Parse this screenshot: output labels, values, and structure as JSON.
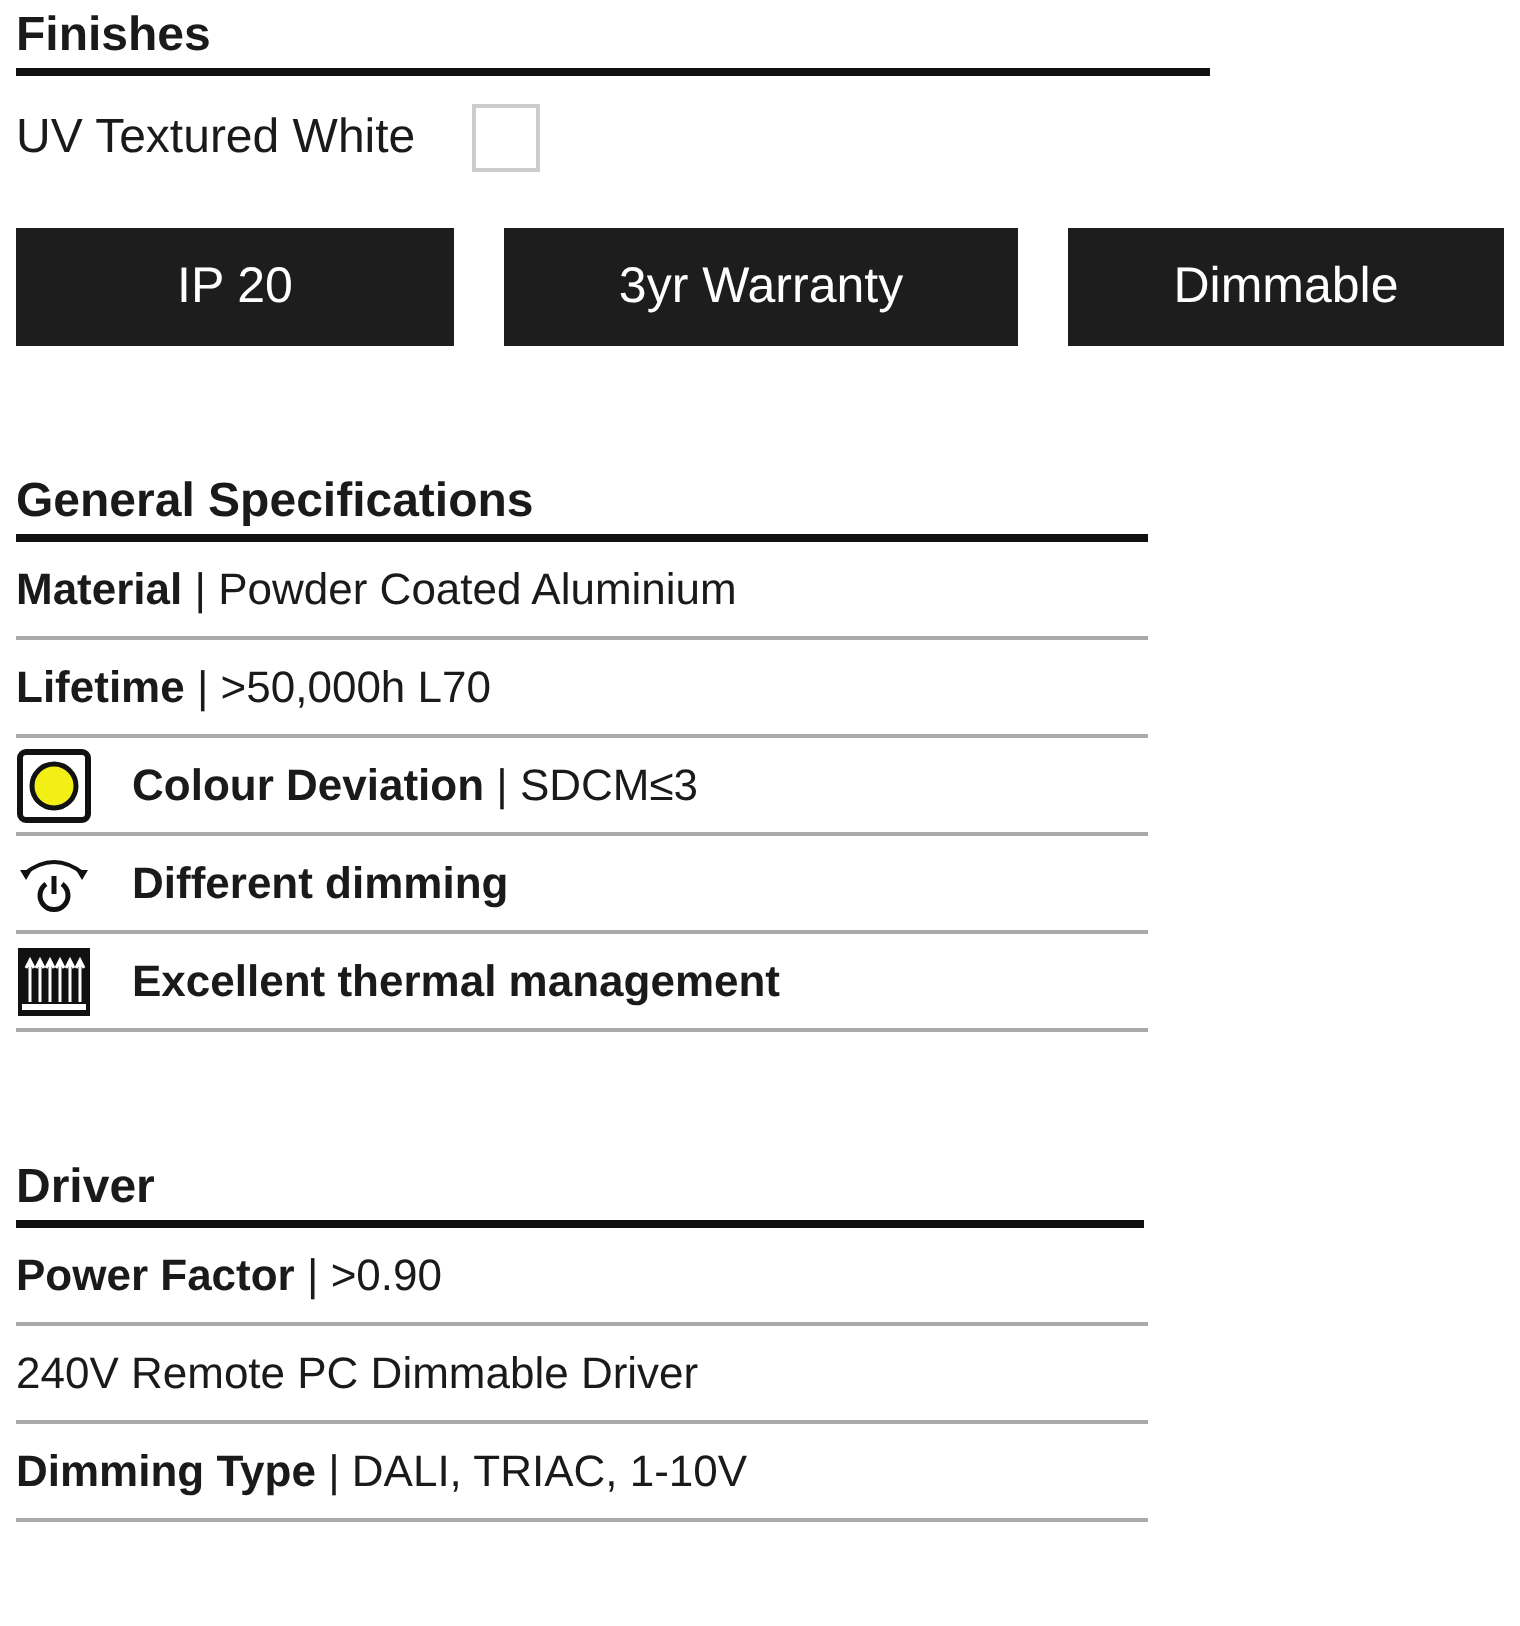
{
  "finishes": {
    "title": "Finishes",
    "options": [
      {
        "label": "UV Textured White",
        "checked": false
      }
    ],
    "badges": [
      "IP 20",
      "3yr Warranty",
      "Dimmable"
    ]
  },
  "general": {
    "title": "General Specifications",
    "rows": [
      {
        "text": "**Material** | Powder Coated Aluminium",
        "bold": false
      },
      {
        "text": "**Lifetime** | >50,000h L70",
        "bold": false
      },
      {
        "kind": "chip",
        "text": "**Colour Deviation** | SDCM≤3",
        "bold": false
      },
      {
        "kind": "dimming",
        "text": "Different dimming",
        "bold": true
      },
      {
        "kind": "heatsink",
        "text": "Excellent thermal management",
        "bold": true
      }
    ]
  },
  "driver": {
    "title": "Driver",
    "rows": [
      {
        "text": "**Power Factor** | >0.90",
        "bold": false
      },
      {
        "text": "240V Remote PC Dimmable Driver",
        "bold": false
      },
      {
        "text": "**Dimming Type** | DALI, TRIAC, 1-10V",
        "bold": false
      }
    ]
  }
}
